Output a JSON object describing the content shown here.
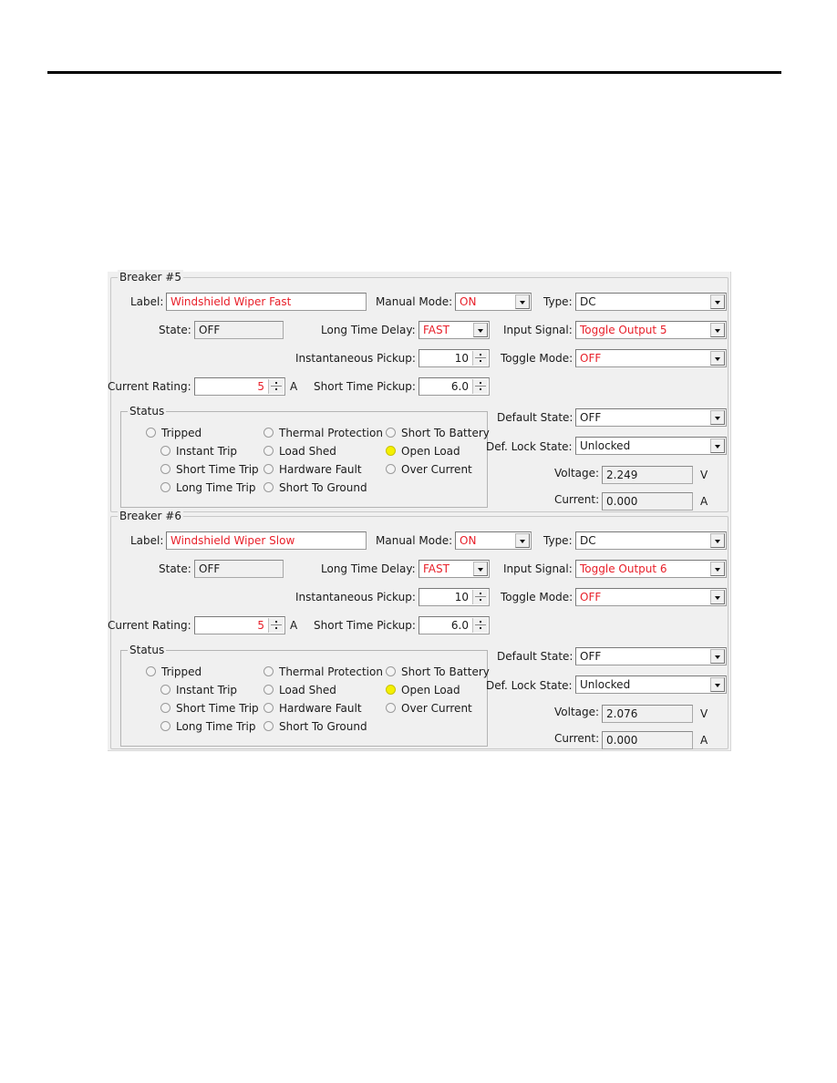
{
  "breakers": [
    {
      "title": "Breaker #5",
      "label_caption": "Label:",
      "label_value": "Windshield Wiper Fast",
      "state_caption": "State:",
      "state_value": "OFF",
      "manual_mode_caption": "Manual Mode:",
      "manual_mode_value": "ON",
      "type_caption": "Type:",
      "type_value": "DC",
      "long_time_delay_caption": "Long Time Delay:",
      "long_time_delay_value": "FAST",
      "input_signal_caption": "Input Signal:",
      "input_signal_value": "Toggle Output 5",
      "instantaneous_pickup_caption": "Instantaneous Pickup:",
      "instantaneous_pickup_value": "10",
      "toggle_mode_caption": "Toggle Mode:",
      "toggle_mode_value": "OFF",
      "current_rating_caption": "Current Rating:",
      "current_rating_value": "5",
      "current_rating_unit": "A",
      "short_time_pickup_caption": "Short Time Pickup:",
      "short_time_pickup_value": "6.0",
      "status_title": "Status",
      "status_items": [
        {
          "label": "Tripped",
          "active": false
        },
        {
          "label": "Instant Trip",
          "active": false
        },
        {
          "label": "Short Time Trip",
          "active": false
        },
        {
          "label": "Long Time Trip",
          "active": false
        },
        {
          "label": "Thermal Protection",
          "active": false
        },
        {
          "label": "Load Shed",
          "active": false
        },
        {
          "label": "Hardware Fault",
          "active": false
        },
        {
          "label": "Short To Ground",
          "active": false
        },
        {
          "label": "Short To Battery",
          "active": false
        },
        {
          "label": "Open Load",
          "active": true
        },
        {
          "label": "Over Current",
          "active": false
        }
      ],
      "default_state_caption": "Default State:",
      "default_state_value": "OFF",
      "def_lock_state_caption": "Def. Lock State:",
      "def_lock_state_value": "Unlocked",
      "voltage_caption": "Voltage:",
      "voltage_value": "2.249",
      "voltage_unit": "V",
      "current_caption": "Current:",
      "current_value": "0.000",
      "current_unit": "A"
    },
    {
      "title": "Breaker #6",
      "label_caption": "Label:",
      "label_value": "Windshield Wiper Slow",
      "state_caption": "State:",
      "state_value": "OFF",
      "manual_mode_caption": "Manual Mode:",
      "manual_mode_value": "ON",
      "type_caption": "Type:",
      "type_value": "DC",
      "long_time_delay_caption": "Long Time Delay:",
      "long_time_delay_value": "FAST",
      "input_signal_caption": "Input Signal:",
      "input_signal_value": "Toggle Output 6",
      "instantaneous_pickup_caption": "Instantaneous Pickup:",
      "instantaneous_pickup_value": "10",
      "toggle_mode_caption": "Toggle Mode:",
      "toggle_mode_value": "OFF",
      "current_rating_caption": "Current Rating:",
      "current_rating_value": "5",
      "current_rating_unit": "A",
      "short_time_pickup_caption": "Short Time Pickup:",
      "short_time_pickup_value": "6.0",
      "status_title": "Status",
      "status_items": [
        {
          "label": "Tripped",
          "active": false
        },
        {
          "label": "Instant Trip",
          "active": false
        },
        {
          "label": "Short Time Trip",
          "active": false
        },
        {
          "label": "Long Time Trip",
          "active": false
        },
        {
          "label": "Thermal Protection",
          "active": false
        },
        {
          "label": "Load Shed",
          "active": false
        },
        {
          "label": "Hardware Fault",
          "active": false
        },
        {
          "label": "Short To Ground",
          "active": false
        },
        {
          "label": "Short To Battery",
          "active": false
        },
        {
          "label": "Open Load",
          "active": true
        },
        {
          "label": "Over Current",
          "active": false
        }
      ],
      "default_state_caption": "Default State:",
      "default_state_value": "OFF",
      "def_lock_state_caption": "Def. Lock State:",
      "def_lock_state_value": "Unlocked",
      "voltage_caption": "Voltage:",
      "voltage_value": "2.076",
      "voltage_unit": "V",
      "current_caption": "Current:",
      "current_value": "0.000",
      "current_unit": "A"
    }
  ],
  "colors": {
    "highlight_text": "#e8202a",
    "active_indicator": "#f4f000",
    "panel_background": "#f0f0f0"
  }
}
